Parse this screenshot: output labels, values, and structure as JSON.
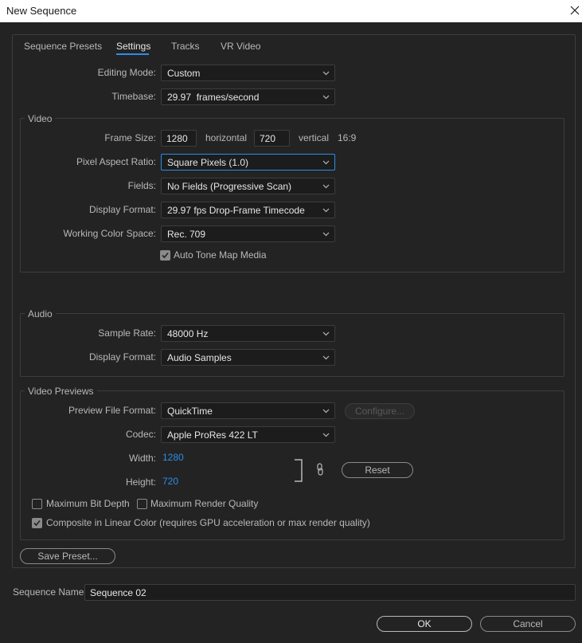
{
  "window": {
    "title": "New Sequence"
  },
  "tabs": [
    "Sequence Presets",
    "Settings",
    "Tracks",
    "VR Video"
  ],
  "settings": {
    "editing_mode": {
      "label": "Editing Mode:",
      "value": "Custom"
    },
    "timebase": {
      "label": "Timebase:",
      "value": "29.97  frames/second"
    }
  },
  "video": {
    "title": "Video",
    "frame_size": {
      "label": "Frame Size:",
      "horizontal": "1280",
      "horizontal_label": "horizontal",
      "vertical": "720",
      "vertical_label": "vertical",
      "aspect": "16:9"
    },
    "pixel_aspect": {
      "label": "Pixel Aspect Ratio:",
      "value": "Square Pixels (1.0)"
    },
    "fields": {
      "label": "Fields:",
      "value": "No Fields (Progressive Scan)"
    },
    "display_format": {
      "label": "Display Format:",
      "value": "29.97 fps Drop-Frame Timecode"
    },
    "color_space": {
      "label": "Working Color Space:",
      "value": "Rec. 709"
    },
    "auto_tone": {
      "label": "Auto Tone Map Media",
      "checked": true
    }
  },
  "audio": {
    "title": "Audio",
    "sample_rate": {
      "label": "Sample Rate:",
      "value": "48000 Hz"
    },
    "display_format": {
      "label": "Display Format:",
      "value": "Audio Samples"
    }
  },
  "previews": {
    "title": "Video Previews",
    "file_format": {
      "label": "Preview File Format:",
      "value": "QuickTime"
    },
    "configure_label": "Configure...",
    "codec": {
      "label": "Codec:",
      "value": "Apple ProRes 422 LT"
    },
    "width": {
      "label": "Width:",
      "value": "1280"
    },
    "height": {
      "label": "Height:",
      "value": "720"
    },
    "reset_label": "Reset",
    "max_bit_depth": {
      "label": "Maximum Bit Depth",
      "checked": false
    },
    "max_render_quality": {
      "label": "Maximum Render Quality",
      "checked": false
    },
    "composite_linear": {
      "label": "Composite in Linear Color (requires GPU acceleration or max render quality)",
      "checked": true
    }
  },
  "save_preset_label": "Save Preset...",
  "sequence_name": {
    "label": "Sequence Name:",
    "value": "Sequence 02"
  },
  "ok_label": "OK",
  "cancel_label": "Cancel",
  "colors": {
    "background": "#232323",
    "field": "#1c1c1c",
    "accent": "#2d8ceb",
    "border": "#3d3d3d"
  }
}
